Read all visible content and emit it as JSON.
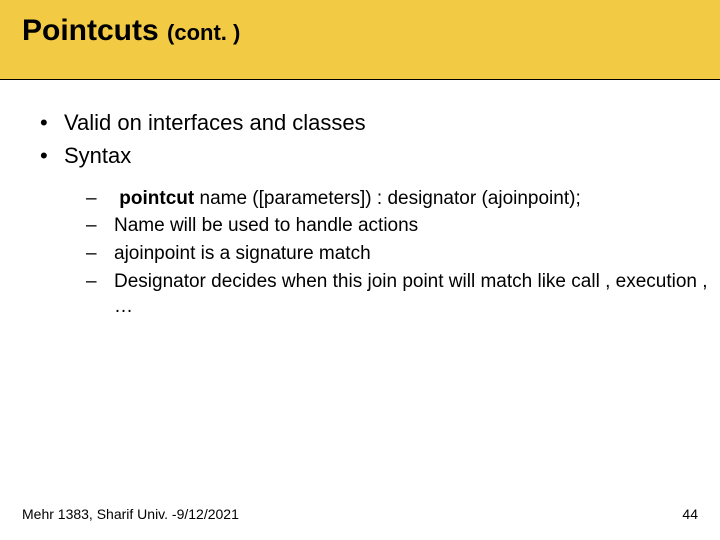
{
  "title": {
    "main": "Pointcuts",
    "cont": "(cont. )"
  },
  "bullets": [
    "Valid on interfaces and classes",
    "Syntax"
  ],
  "sub": {
    "item0_bold": "pointcut",
    "item0_rest": " name ([parameters]) : designator (ajoinpoint);",
    "item1": "Name will be used to handle actions",
    "item2": "ajoinpoint is a signature match",
    "item3": "Designator decides when this join point will match like call , execution , …"
  },
  "footer": {
    "left": "Mehr 1383,  Sharif Univ. -9/12/2021",
    "right": "44"
  }
}
